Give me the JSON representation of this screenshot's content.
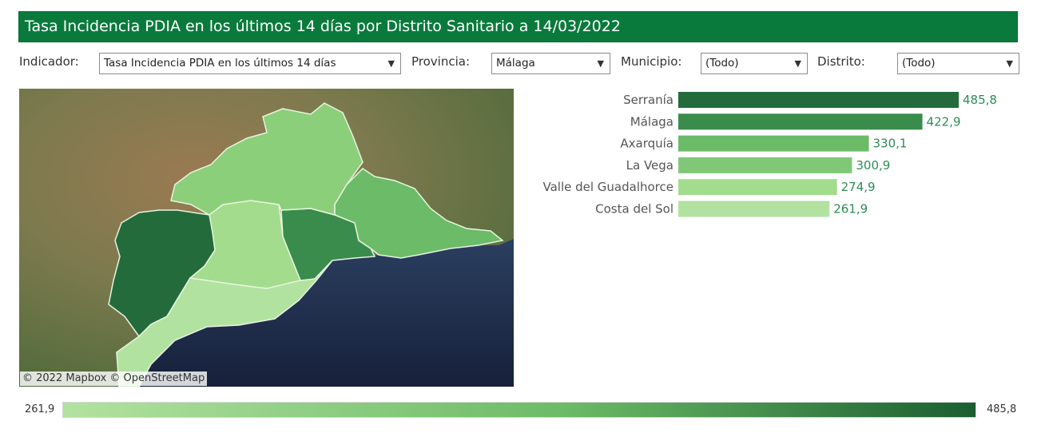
{
  "title": "Tasa Incidencia PDIA en los últimos 14 días por Distrito Sanitario a 14/03/2022",
  "filters": {
    "indicador_label": "Indicador:",
    "indicador_value": "Tasa Incidencia PDIA en los últimos 14 días",
    "provincia_label": "Provincia:",
    "provincia_value": "Málaga",
    "municipio_label": "Municipio:",
    "municipio_value": "(Todo)",
    "distrito_label": "Distrito:",
    "distrito_value": "(Todo)"
  },
  "map": {
    "attribution": "© 2022 Mapbox © OpenStreetMap",
    "districts": [
      {
        "name": "Serranía",
        "fill": "#236b3b"
      },
      {
        "name": "Málaga",
        "fill": "#3a8c4c"
      },
      {
        "name": "Axarquía",
        "fill": "#6bbb68"
      },
      {
        "name": "La Vega",
        "fill": "#8ccf7a"
      },
      {
        "name": "Valle del Guadalhorce",
        "fill": "#a3dc8d"
      },
      {
        "name": "Costa del Sol",
        "fill": "#b2e2a0"
      }
    ]
  },
  "chart_data": {
    "type": "bar",
    "orientation": "horizontal",
    "categories": [
      "Serranía",
      "Málaga",
      "Axarquía",
      "La Vega",
      "Valle del Guadalhorce",
      "Costa del Sol"
    ],
    "values": [
      485.8,
      422.9,
      330.1,
      300.9,
      274.9,
      261.9
    ],
    "value_labels": [
      "485,8",
      "422,9",
      "330,1",
      "300,9",
      "274,9",
      "261,9"
    ],
    "colors": [
      "#236b3b",
      "#3a8c4c",
      "#6bbb68",
      "#80c878",
      "#a3dc8d",
      "#b2e2a0"
    ],
    "xlim": [
      0,
      485.8
    ],
    "label_color": "#2e8b57",
    "grid": false
  },
  "legend": {
    "min_label": "261,9",
    "max_label": "485,8",
    "color_start": "#b2e2a0",
    "color_end": "#1b5e30"
  }
}
